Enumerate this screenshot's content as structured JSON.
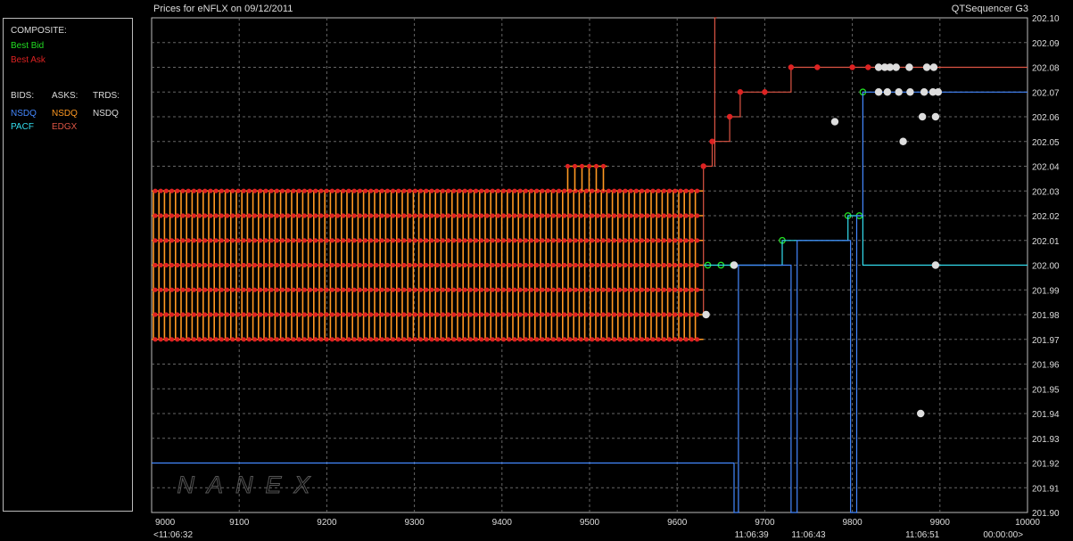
{
  "header": {
    "title_left": "Prices for  eNFLX  on  09/12/2011",
    "title_right": "QTSequencer G3"
  },
  "legend": {
    "composite_label": "COMPOSITE:",
    "best_bid": "Best Bid",
    "best_ask": "Best Ask",
    "bids_label": "BIDS:",
    "asks_label": "ASKS:",
    "trds_label": "TRDS:",
    "bids": [
      "NSDQ",
      "PACF"
    ],
    "asks": [
      "NSDQ",
      "EDGX"
    ],
    "trds": [
      "NSDQ"
    ],
    "colors": {
      "best_bid": "#22dd22",
      "best_ask": "#dd2222",
      "bid_nsdq": "#4488ff",
      "bid_pacf": "#33ddee",
      "ask_nsdq": "#ff9922",
      "ask_edgx": "#dd5544",
      "trade": "#dddddd"
    }
  },
  "watermark": "NANEX",
  "chart_data": {
    "type": "line",
    "title": "Prices for  eNFLX  on  09/12/2011",
    "xlim": [
      9000,
      10000
    ],
    "ylim": [
      201.9,
      202.1
    ],
    "grid": true,
    "x_ticks": [
      9000,
      9100,
      9200,
      9300,
      9400,
      9500,
      9600,
      9700,
      9800,
      9900,
      10000
    ],
    "y_ticks": [
      "201.90",
      "201.91",
      "201.92",
      "201.93",
      "201.94",
      "201.95",
      "201.96",
      "201.97",
      "201.98",
      "201.99",
      "202.00",
      "202.01",
      "202.02",
      "202.03",
      "202.04",
      "202.05",
      "202.06",
      "202.07",
      "202.08",
      "202.09",
      "202.10"
    ],
    "time_labels": [
      {
        "x": 9000,
        "text": "<11:06:32"
      },
      {
        "x": 9685,
        "text": "11:06:39"
      },
      {
        "x": 9750,
        "text": "11:06:43"
      },
      {
        "x": 9880,
        "text": "11:06:51"
      },
      {
        "x": 9995,
        "text": "00:00:00>"
      }
    ],
    "series": [
      {
        "name": "NSDQ",
        "role": "ask",
        "note": "oscillating quotes between 201.97 and 202.03",
        "x": [
          9000,
          9630
        ],
        "ymin": 201.97,
        "ymax": 202.03,
        "levels": [
          201.97,
          201.98,
          201.99,
          202.0,
          202.01,
          202.02,
          202.03
        ],
        "burst": {
          "x": [
            9475,
            9520
          ],
          "y": 202.04
        }
      },
      {
        "name": "Best Ask",
        "role": "composite_ask",
        "x": [
          9630,
          9630,
          9640,
          9640,
          9660,
          9660,
          9672,
          9672,
          9700,
          9700,
          9730,
          9730,
          9760,
          9760,
          9800,
          9800,
          9818,
          9818,
          9840,
          9840,
          10000
        ],
        "y": [
          201.98,
          202.04,
          202.04,
          202.05,
          202.05,
          202.06,
          202.06,
          202.07,
          202.07,
          202.07,
          202.07,
          202.08,
          202.08,
          202.08,
          202.08,
          202.08,
          202.08,
          202.08,
          202.08,
          202.08,
          202.08
        ]
      },
      {
        "name": "EDGX",
        "role": "ask",
        "x": [
          9643,
          9643,
          9645
        ],
        "y": [
          202.04,
          202.12,
          202.12
        ]
      },
      {
        "name": "Best Bid",
        "role": "composite_bid",
        "markers": [
          {
            "x": 9635,
            "y": 202.0
          },
          {
            "x": 9650,
            "y": 202.0
          },
          {
            "x": 9664,
            "y": 202.0
          },
          {
            "x": 9720,
            "y": 202.01
          },
          {
            "x": 9795,
            "y": 202.02
          },
          {
            "x": 9808,
            "y": 202.02
          },
          {
            "x": 9812,
            "y": 202.07
          }
        ]
      },
      {
        "name": "PACF",
        "role": "bid",
        "x": [
          9630,
          9720,
          9720,
          9732,
          9732,
          9795,
          9795,
          9812,
          9812,
          10000
        ],
        "y": [
          202.0,
          202.0,
          202.01,
          202.01,
          202.01,
          202.01,
          202.02,
          202.02,
          202.0,
          202.0
        ]
      },
      {
        "name": "NSDQ",
        "role": "bid",
        "x": [
          9000,
          9665,
          9665,
          9670,
          9670,
          9730,
          9730,
          9737,
          9737,
          9798,
          9798,
          9805,
          9805,
          9812,
          9812,
          10000
        ],
        "y": [
          201.92,
          201.92,
          201.9,
          201.9,
          202.0,
          202.0,
          201.9,
          201.9,
          202.01,
          202.01,
          201.9,
          201.9,
          202.02,
          202.02,
          202.07,
          202.07
        ]
      },
      {
        "name": "NSDQ",
        "role": "trade",
        "points": [
          {
            "x": 9633,
            "y": 201.98
          },
          {
            "x": 9665,
            "y": 202.0
          },
          {
            "x": 9780,
            "y": 202.058
          },
          {
            "x": 9830,
            "y": 202.08
          },
          {
            "x": 9837,
            "y": 202.08
          },
          {
            "x": 9843,
            "y": 202.08
          },
          {
            "x": 9850,
            "y": 202.08
          },
          {
            "x": 9865,
            "y": 202.08
          },
          {
            "x": 9885,
            "y": 202.08
          },
          {
            "x": 9893,
            "y": 202.08
          },
          {
            "x": 9830,
            "y": 202.07
          },
          {
            "x": 9840,
            "y": 202.07
          },
          {
            "x": 9853,
            "y": 202.07
          },
          {
            "x": 9866,
            "y": 202.07
          },
          {
            "x": 9882,
            "y": 202.07
          },
          {
            "x": 9892,
            "y": 202.07
          },
          {
            "x": 9898,
            "y": 202.07
          },
          {
            "x": 9880,
            "y": 202.06
          },
          {
            "x": 9895,
            "y": 202.06
          },
          {
            "x": 9858,
            "y": 202.05
          },
          {
            "x": 9878,
            "y": 201.94
          },
          {
            "x": 9895,
            "y": 202.0
          }
        ]
      }
    ]
  }
}
